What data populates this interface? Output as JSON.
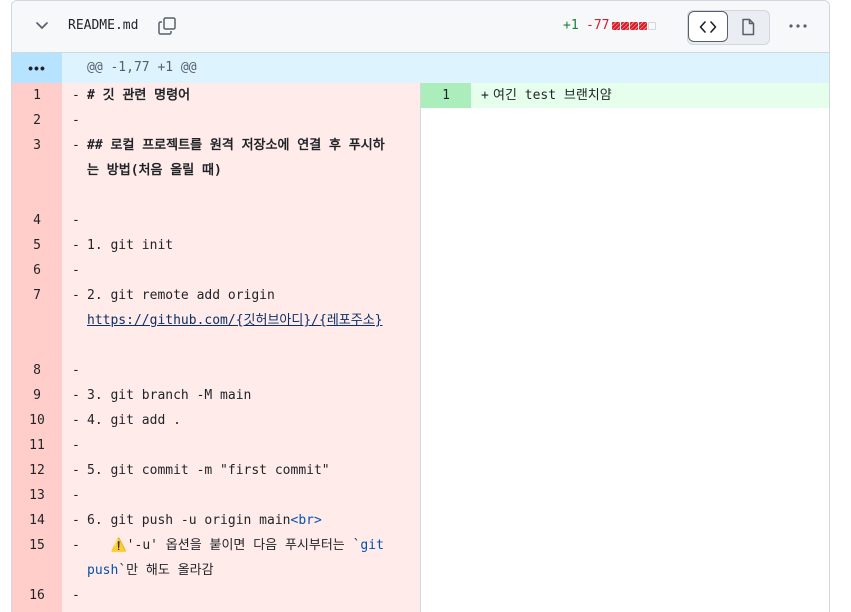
{
  "header": {
    "filename": "README.md",
    "additions": "+1",
    "deletions": "-77",
    "diffstat": [
      "deleted",
      "deleted",
      "deleted",
      "deleted",
      "neutral"
    ],
    "icons": [
      "chevron-down-icon",
      "copy-icon",
      "code-icon",
      "file-icon",
      "kebab-horizontal-icon"
    ]
  },
  "hunk": {
    "expand": "•••",
    "header": "@@ -1,77 +1 @@"
  },
  "left_lines": [
    {
      "num": "1",
      "mark": "-",
      "text": "# 깃 관련 명령어",
      "style": "heading"
    },
    {
      "num": "2",
      "mark": "-",
      "text": ""
    },
    {
      "num": "3",
      "mark": "-",
      "text": "## 로컬 프로젝트를 원격 저장소에 연결 후 푸시하는 방법(처음 올릴 때)",
      "style": "heading"
    },
    {
      "num": "4",
      "mark": "-",
      "text": ""
    },
    {
      "num": "5",
      "mark": "-",
      "text": "1. git init",
      "style": "list"
    },
    {
      "num": "6",
      "mark": "-",
      "text": ""
    },
    {
      "num": "7",
      "mark": "-",
      "text": "2. git remote add origin",
      "link": "https://github.com/{깃허브아디}/{레포주소}",
      "style": "list"
    },
    {
      "num": "8",
      "mark": "-",
      "text": ""
    },
    {
      "num": "9",
      "mark": "-",
      "text": "3. git branch -M main",
      "style": "list"
    },
    {
      "num": "10",
      "mark": "-",
      "text": "4. git add .",
      "style": "list"
    },
    {
      "num": "11",
      "mark": "-",
      "text": ""
    },
    {
      "num": "12",
      "mark": "-",
      "text": "5. git commit -m \"first commit\"",
      "style": "list"
    },
    {
      "num": "13",
      "mark": "-",
      "text": ""
    },
    {
      "num": "14",
      "mark": "-",
      "text": "6. git push -u origin main",
      "tag": "<br>",
      "style": "list"
    },
    {
      "num": "15",
      "mark": "-",
      "pre": "   ⚠️'-u' 옵션을 붙이면 다음 푸시부터는 `",
      "code": "git push",
      "post": "`만 해도 올라감"
    },
    {
      "num": "16",
      "mark": "-",
      "text": ""
    }
  ],
  "right_lines": [
    {
      "num": "1",
      "mark": "+",
      "text": "여긴 test 브랜치얌"
    }
  ],
  "colors": {
    "deleted_bg": "#ffebe9",
    "deleted_gutter": "#ffcecb",
    "added_bg": "#e6ffec",
    "added_gutter": "#aceebb",
    "hunk_bg": "#ddf4ff",
    "addition_text": "#1a7f37",
    "deletion_text": "#cf222e"
  }
}
